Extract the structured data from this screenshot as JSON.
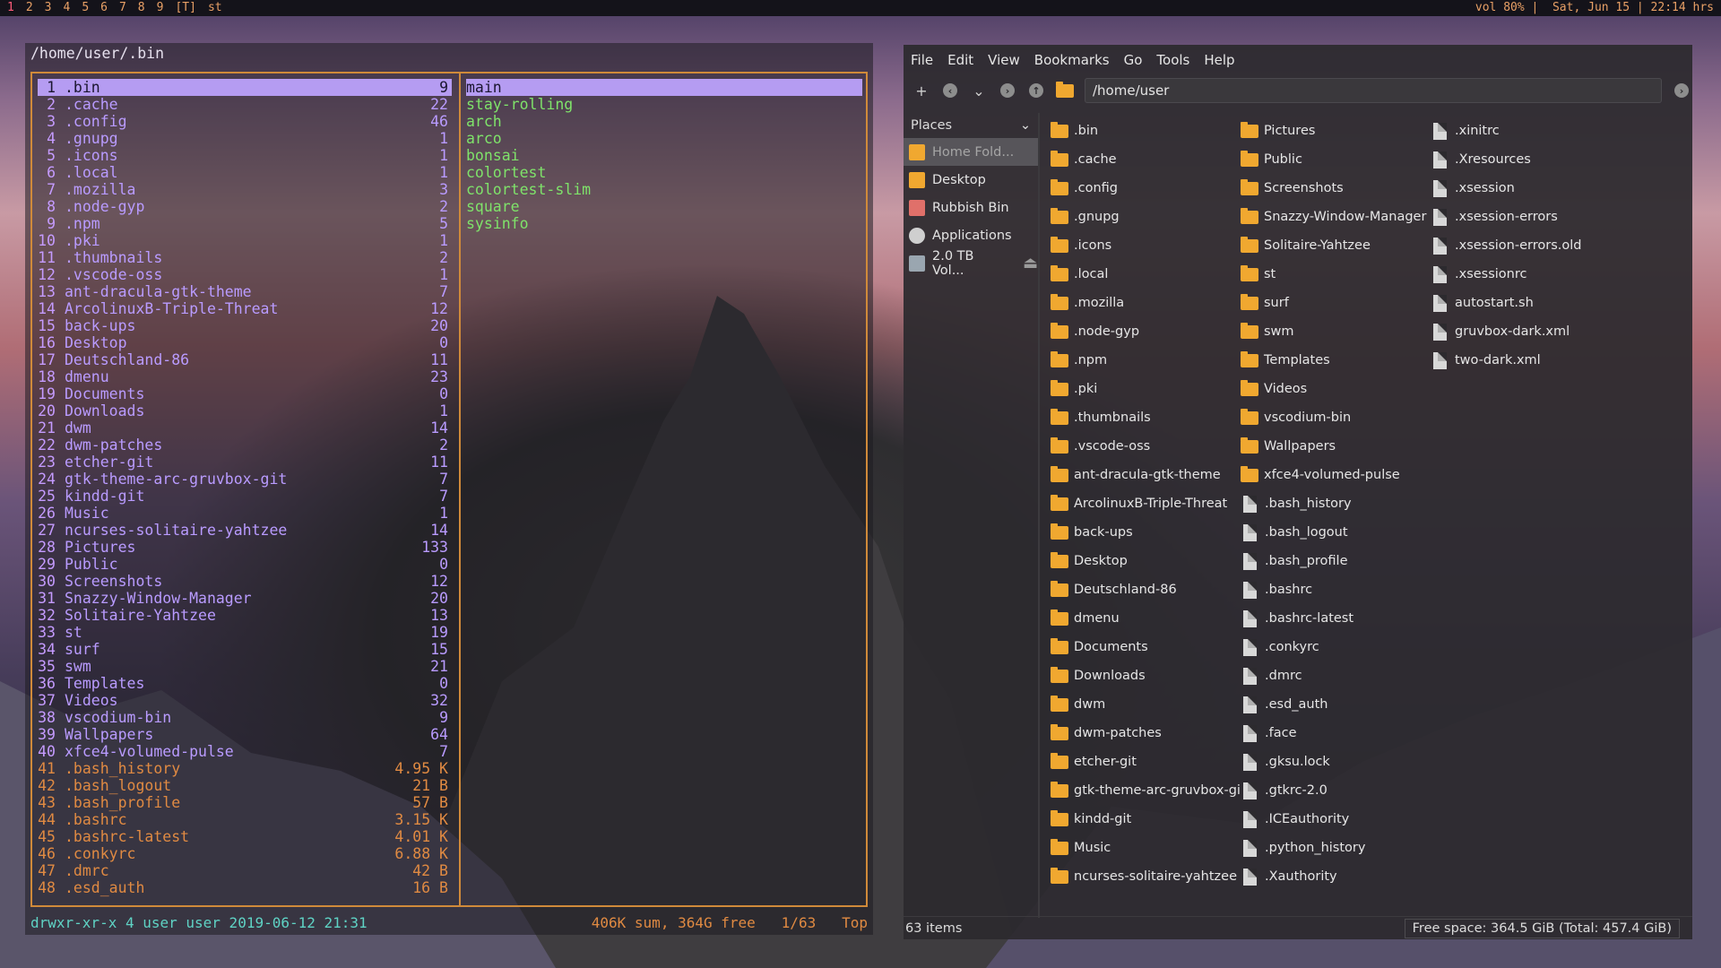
{
  "topbar": {
    "workspaces": [
      "1",
      "2",
      "3",
      "4",
      "5",
      "6",
      "7",
      "8",
      "9"
    ],
    "layout": "[T]",
    "window": "st",
    "status": "vol 80% |  Sat, Jun 15 | 22:14 hrs"
  },
  "terminal": {
    "title": "/home/user/.bin",
    "left_pane": [
      {
        "n": "1",
        "name": ".bin",
        "size": "9",
        "kind": "dir",
        "selected": true
      },
      {
        "n": "2",
        "name": ".cache",
        "size": "22",
        "kind": "dir"
      },
      {
        "n": "3",
        "name": ".config",
        "size": "46",
        "kind": "dir"
      },
      {
        "n": "4",
        "name": ".gnupg",
        "size": "1",
        "kind": "dir"
      },
      {
        "n": "5",
        "name": ".icons",
        "size": "1",
        "kind": "dir"
      },
      {
        "n": "6",
        "name": ".local",
        "size": "1",
        "kind": "dir"
      },
      {
        "n": "7",
        "name": ".mozilla",
        "size": "3",
        "kind": "dir"
      },
      {
        "n": "8",
        "name": ".node-gyp",
        "size": "2",
        "kind": "dir"
      },
      {
        "n": "9",
        "name": ".npm",
        "size": "5",
        "kind": "dir"
      },
      {
        "n": "10",
        "name": ".pki",
        "size": "1",
        "kind": "dir"
      },
      {
        "n": "11",
        "name": ".thumbnails",
        "size": "2",
        "kind": "dir"
      },
      {
        "n": "12",
        "name": ".vscode-oss",
        "size": "1",
        "kind": "dir"
      },
      {
        "n": "13",
        "name": "ant-dracula-gtk-theme",
        "size": "7",
        "kind": "dir"
      },
      {
        "n": "14",
        "name": "ArcolinuxB-Triple-Threat",
        "size": "12",
        "kind": "dir"
      },
      {
        "n": "15",
        "name": "back-ups",
        "size": "20",
        "kind": "dir"
      },
      {
        "n": "16",
        "name": "Desktop",
        "size": "0",
        "kind": "dir"
      },
      {
        "n": "17",
        "name": "Deutschland-86",
        "size": "11",
        "kind": "dir"
      },
      {
        "n": "18",
        "name": "dmenu",
        "size": "23",
        "kind": "dir"
      },
      {
        "n": "19",
        "name": "Documents",
        "size": "0",
        "kind": "dir"
      },
      {
        "n": "20",
        "name": "Downloads",
        "size": "1",
        "kind": "dir"
      },
      {
        "n": "21",
        "name": "dwm",
        "size": "14",
        "kind": "dir"
      },
      {
        "n": "22",
        "name": "dwm-patches",
        "size": "2",
        "kind": "dir"
      },
      {
        "n": "23",
        "name": "etcher-git",
        "size": "11",
        "kind": "dir"
      },
      {
        "n": "24",
        "name": "gtk-theme-arc-gruvbox-git",
        "size": "7",
        "kind": "dir"
      },
      {
        "n": "25",
        "name": "kindd-git",
        "size": "7",
        "kind": "dir"
      },
      {
        "n": "26",
        "name": "Music",
        "size": "1",
        "kind": "dir"
      },
      {
        "n": "27",
        "name": "ncurses-solitaire-yahtzee",
        "size": "14",
        "kind": "dir"
      },
      {
        "n": "28",
        "name": "Pictures",
        "size": "133",
        "kind": "dir"
      },
      {
        "n": "29",
        "name": "Public",
        "size": "0",
        "kind": "dir"
      },
      {
        "n": "30",
        "name": "Screenshots",
        "size": "12",
        "kind": "dir"
      },
      {
        "n": "31",
        "name": "Snazzy-Window-Manager",
        "size": "20",
        "kind": "dir"
      },
      {
        "n": "32",
        "name": "Solitaire-Yahtzee",
        "size": "13",
        "kind": "dir"
      },
      {
        "n": "33",
        "name": "st",
        "size": "19",
        "kind": "dir"
      },
      {
        "n": "34",
        "name": "surf",
        "size": "15",
        "kind": "dir"
      },
      {
        "n": "35",
        "name": "swm",
        "size": "21",
        "kind": "dir"
      },
      {
        "n": "36",
        "name": "Templates",
        "size": "0",
        "kind": "dir"
      },
      {
        "n": "37",
        "name": "Videos",
        "size": "32",
        "kind": "dir"
      },
      {
        "n": "38",
        "name": "vscodium-bin",
        "size": "9",
        "kind": "dir"
      },
      {
        "n": "39",
        "name": "Wallpapers",
        "size": "64",
        "kind": "dir"
      },
      {
        "n": "40",
        "name": "xfce4-volumed-pulse",
        "size": "7",
        "kind": "dir"
      },
      {
        "n": "41",
        "name": ".bash_history",
        "size": "4.95 K",
        "kind": "file"
      },
      {
        "n": "42",
        "name": ".bash_logout",
        "size": "21 B",
        "kind": "file"
      },
      {
        "n": "43",
        "name": ".bash_profile",
        "size": "57 B",
        "kind": "file"
      },
      {
        "n": "44",
        "name": ".bashrc",
        "size": "3.15 K",
        "kind": "file"
      },
      {
        "n": "45",
        "name": ".bashrc-latest",
        "size": "4.01 K",
        "kind": "file"
      },
      {
        "n": "46",
        "name": ".conkyrc",
        "size": "6.88 K",
        "kind": "file"
      },
      {
        "n": "47",
        "name": ".dmrc",
        "size": "42 B",
        "kind": "file"
      },
      {
        "n": "48",
        "name": ".esd_auth",
        "size": "16 B",
        "kind": "file"
      }
    ],
    "right_pane": [
      "main",
      "stay-rolling",
      "arch",
      "arco",
      "bonsai",
      "colortest",
      "colortest-slim",
      "square",
      "sysinfo"
    ],
    "status_perm": "drwxr-xr-x 4 user user 2019-06-12 21:31",
    "status_info": "406K sum, 364G free   1/63   Top"
  },
  "filemanager": {
    "menu": [
      "File",
      "Edit",
      "View",
      "Bookmarks",
      "Go",
      "Tools",
      "Help"
    ],
    "path": "/home/user",
    "places_title": "Places",
    "places": [
      {
        "label": "Home Fold...",
        "icon": "home-folder-icon",
        "active": true
      },
      {
        "label": "Desktop",
        "icon": "desktop-folder-icon"
      },
      {
        "label": "Rubbish Bin",
        "icon": "trash-icon"
      },
      {
        "label": "Applications",
        "icon": "applications-icon"
      },
      {
        "label": "2.0 TB Vol...",
        "icon": "drive-icon"
      }
    ],
    "items": [
      {
        "name": ".bin",
        "type": "folder"
      },
      {
        "name": ".cache",
        "type": "folder"
      },
      {
        "name": ".config",
        "type": "folder"
      },
      {
        "name": ".gnupg",
        "type": "folder"
      },
      {
        "name": ".icons",
        "type": "folder"
      },
      {
        "name": ".local",
        "type": "folder"
      },
      {
        "name": ".mozilla",
        "type": "folder"
      },
      {
        "name": ".node-gyp",
        "type": "folder"
      },
      {
        "name": ".npm",
        "type": "folder"
      },
      {
        "name": ".pki",
        "type": "folder"
      },
      {
        "name": ".thumbnails",
        "type": "folder"
      },
      {
        "name": ".vscode-oss",
        "type": "folder"
      },
      {
        "name": "ant-dracula-gtk-theme",
        "type": "folder"
      },
      {
        "name": "ArcolinuxB-Triple-Threat",
        "type": "folder"
      },
      {
        "name": "back-ups",
        "type": "folder"
      },
      {
        "name": "Desktop",
        "type": "folder"
      },
      {
        "name": "Deutschland-86",
        "type": "folder"
      },
      {
        "name": "dmenu",
        "type": "folder"
      },
      {
        "name": "Documents",
        "type": "folder"
      },
      {
        "name": "Downloads",
        "type": "folder"
      },
      {
        "name": "dwm",
        "type": "folder"
      },
      {
        "name": "dwm-patches",
        "type": "folder"
      },
      {
        "name": "etcher-git",
        "type": "folder"
      },
      {
        "name": "gtk-theme-arc-gruvbox-git",
        "type": "folder"
      },
      {
        "name": "kindd-git",
        "type": "folder"
      },
      {
        "name": "Music",
        "type": "folder"
      },
      {
        "name": "ncurses-solitaire-yahtzee",
        "type": "folder"
      },
      {
        "name": "Pictures",
        "type": "folder"
      },
      {
        "name": "Public",
        "type": "folder"
      },
      {
        "name": "Screenshots",
        "type": "folder"
      },
      {
        "name": "Snazzy-Window-Manager",
        "type": "folder"
      },
      {
        "name": "Solitaire-Yahtzee",
        "type": "folder"
      },
      {
        "name": "st",
        "type": "folder"
      },
      {
        "name": "surf",
        "type": "folder"
      },
      {
        "name": "swm",
        "type": "folder"
      },
      {
        "name": "Templates",
        "type": "folder"
      },
      {
        "name": "Videos",
        "type": "folder"
      },
      {
        "name": "vscodium-bin",
        "type": "folder"
      },
      {
        "name": "Wallpapers",
        "type": "folder"
      },
      {
        "name": "xfce4-volumed-pulse",
        "type": "folder"
      },
      {
        "name": ".bash_history",
        "type": "file"
      },
      {
        "name": ".bash_logout",
        "type": "file"
      },
      {
        "name": ".bash_profile",
        "type": "file"
      },
      {
        "name": ".bashrc",
        "type": "file"
      },
      {
        "name": ".bashrc-latest",
        "type": "file"
      },
      {
        "name": ".conkyrc",
        "type": "file"
      },
      {
        "name": ".dmrc",
        "type": "file"
      },
      {
        "name": ".esd_auth",
        "type": "file"
      },
      {
        "name": ".face",
        "type": "file"
      },
      {
        "name": ".gksu.lock",
        "type": "file"
      },
      {
        "name": ".gtkrc-2.0",
        "type": "file"
      },
      {
        "name": ".ICEauthority",
        "type": "file"
      },
      {
        "name": ".python_history",
        "type": "file"
      },
      {
        "name": ".Xauthority",
        "type": "file"
      },
      {
        "name": ".xinitrc",
        "type": "file"
      },
      {
        "name": ".Xresources",
        "type": "file"
      },
      {
        "name": ".xsession",
        "type": "file"
      },
      {
        "name": ".xsession-errors",
        "type": "file"
      },
      {
        "name": ".xsession-errors.old",
        "type": "file"
      },
      {
        "name": ".xsessionrc",
        "type": "file"
      },
      {
        "name": "autostart.sh",
        "type": "file"
      },
      {
        "name": "gruvbox-dark.xml",
        "type": "file"
      },
      {
        "name": "two-dark.xml",
        "type": "file"
      }
    ],
    "status_items": "63 items",
    "status_free": "Free space: 364.5 GiB (Total: 457.4 GiB)"
  }
}
